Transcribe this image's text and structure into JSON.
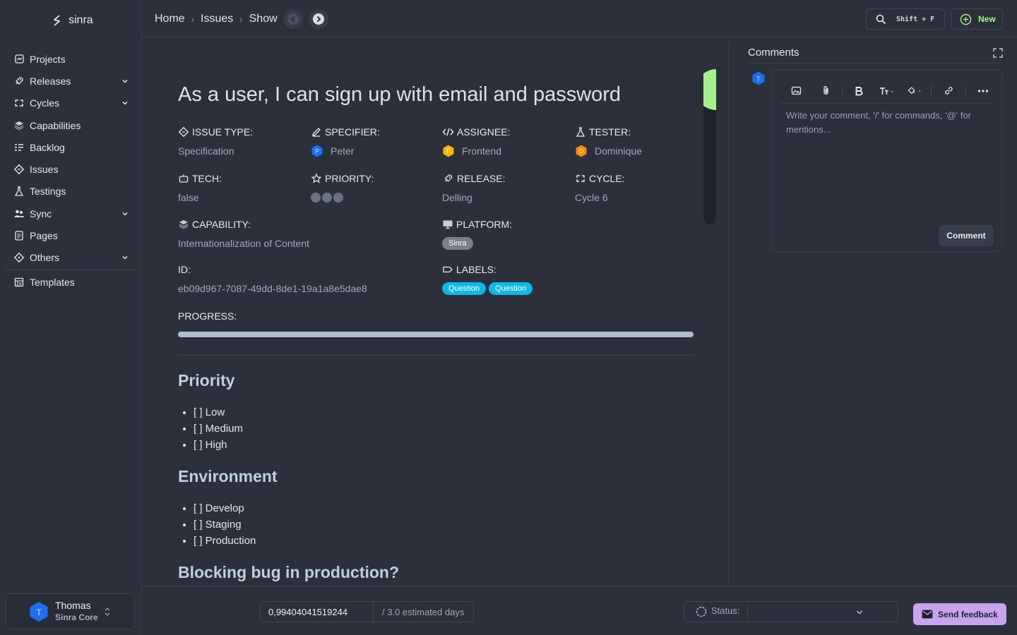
{
  "brand": {
    "name": "sinra"
  },
  "sidebar": {
    "items": [
      {
        "label": "Projects",
        "icon": "projects-icon",
        "expandable": false
      },
      {
        "label": "Releases",
        "icon": "rocket-icon",
        "expandable": true
      },
      {
        "label": "Cycles",
        "icon": "cycles-icon",
        "expandable": true
      },
      {
        "label": "Capabilities",
        "icon": "layers-icon",
        "expandable": false
      },
      {
        "label": "Backlog",
        "icon": "backlog-icon",
        "expandable": false
      },
      {
        "label": "Issues",
        "icon": "diamond-icon",
        "expandable": false
      },
      {
        "label": "Testings",
        "icon": "flask-icon",
        "expandable": false
      },
      {
        "label": "Sync",
        "icon": "users-icon",
        "expandable": true
      },
      {
        "label": "Pages",
        "icon": "document-icon",
        "expandable": false
      },
      {
        "label": "Others",
        "icon": "diamond-icon",
        "expandable": true
      },
      {
        "label": "Templates",
        "icon": "template-icon",
        "expandable": false
      }
    ]
  },
  "user": {
    "initial": "T",
    "name": "Thomas",
    "org": "Sinra Core"
  },
  "breadcrumb": {
    "home": "Home",
    "issues": "Issues",
    "show": "Show"
  },
  "search": {
    "shortcut": "Shift + F"
  },
  "new_button": {
    "label": "New"
  },
  "issue": {
    "title": "As a user, I can sign up with email and password",
    "fields": {
      "issue_type": {
        "label": "ISSUE TYPE:",
        "value": "Specification"
      },
      "specifier": {
        "label": "SPECIFIER:",
        "value": "Peter",
        "initial": "P",
        "color": "#1d6ff2"
      },
      "assignee": {
        "label": "ASSIGNEE:",
        "value": "Frontend",
        "initial": "F",
        "color": "#f5b50a"
      },
      "tester": {
        "label": "TESTER:",
        "value": "Dominique",
        "initial": "D",
        "color": "#f58a0a"
      },
      "tech": {
        "label": "TECH:",
        "value": "false"
      },
      "priority": {
        "label": "PRIORITY:",
        "level": 0,
        "max": 3
      },
      "release": {
        "label": "RELEASE:",
        "value": "Delling"
      },
      "cycle": {
        "label": "CYCLE:",
        "value": "Cycle 6"
      },
      "capability": {
        "label": "CAPABILITY:",
        "value": "Internationalization of Content"
      },
      "platform": {
        "label": "PLATFORM:",
        "value": "Sinra"
      },
      "id": {
        "label": "ID:",
        "value": "eb09d967-7087-49dd-8de1-19a1a8e5dae8"
      },
      "labels": {
        "label": "LABELS:",
        "values": [
          "Question",
          "Question"
        ]
      },
      "progress": {
        "label": "PROGRESS:",
        "percent": 100
      }
    },
    "description": {
      "priority_heading": "Priority",
      "priority_items": [
        "[ ] Low",
        "[ ] Medium",
        "[ ] High"
      ],
      "environment_heading": "Environment",
      "environment_items": [
        "[ ] Develop",
        "[ ] Staging",
        "[ ] Production"
      ],
      "blocking_heading": "Blocking bug in production?"
    }
  },
  "comments": {
    "title": "Comments",
    "avatar_initial": "T",
    "placeholder": "Write your comment, '/' for commands, '@' for mentions...",
    "submit_label": "Comment"
  },
  "footer": {
    "estimate_value": "0,99404041519244",
    "estimate_unit": "/ 3.0 estimated days",
    "status_label": "Status:",
    "feedback_label": "Send feedback"
  },
  "colors": {
    "background": "#2b303b",
    "accent_green": "#a5f08c",
    "label_cyan": "#0fb9e4",
    "feedback_purple": "#c9a3ee"
  }
}
